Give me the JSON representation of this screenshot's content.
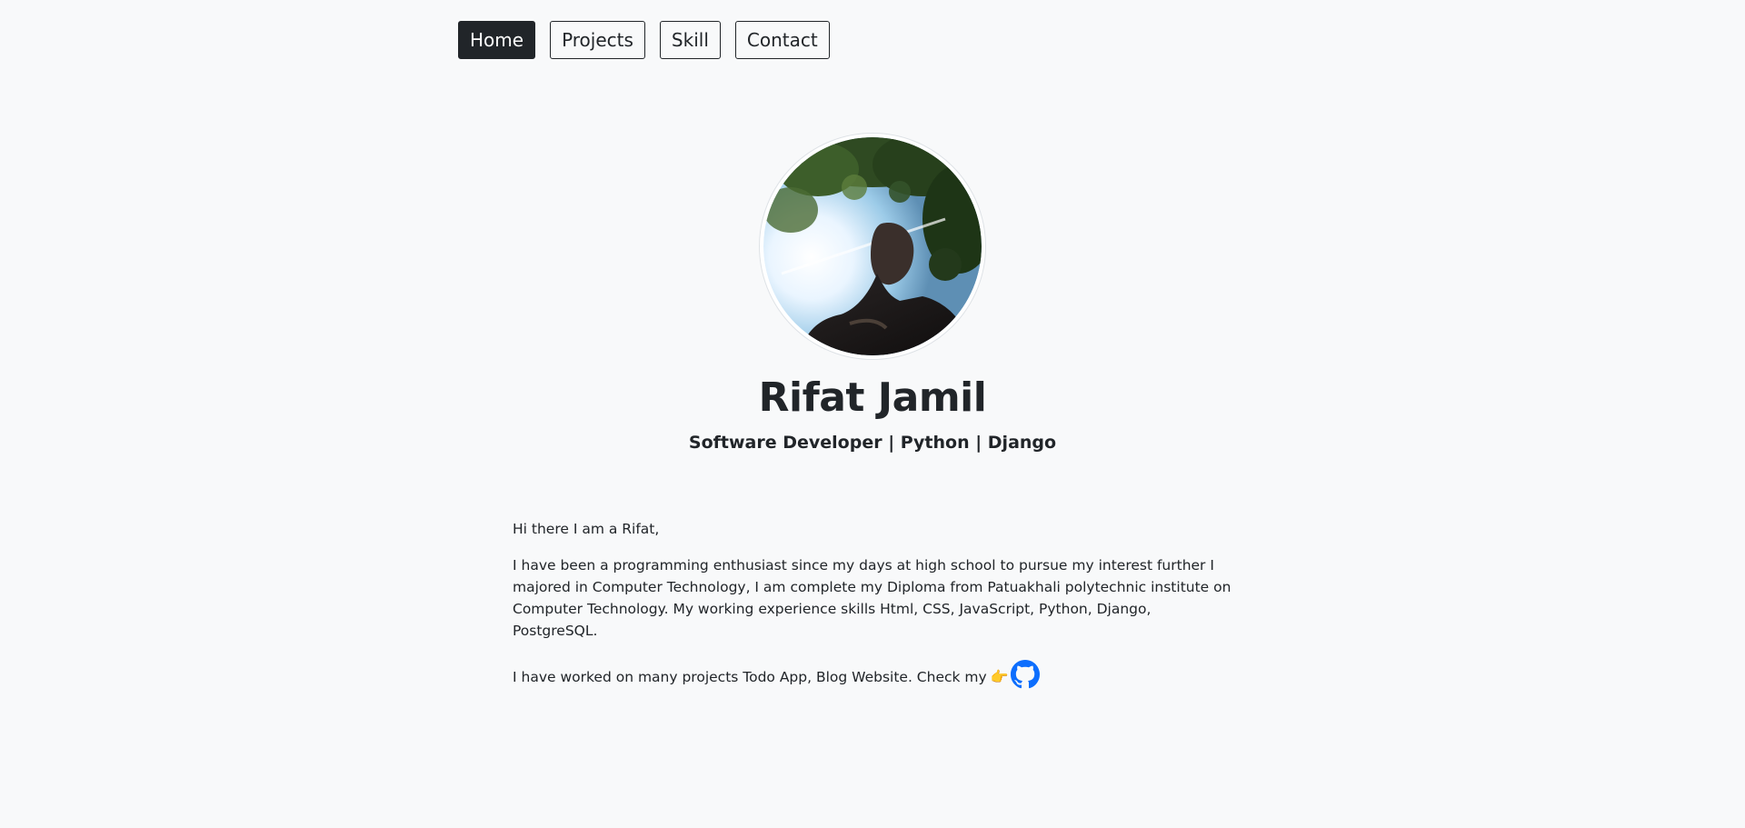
{
  "nav": {
    "items": [
      {
        "label": "Home",
        "active": true
      },
      {
        "label": "Projects",
        "active": false
      },
      {
        "label": "Skill",
        "active": false
      },
      {
        "label": "Contact",
        "active": false
      }
    ]
  },
  "profile": {
    "name": "Rifat Jamil",
    "tagline": "Software Developer | Python | Django",
    "avatar_icon": "profile-photo"
  },
  "about": {
    "greeting": "Hi there I am a Rifat,",
    "bio": "I have been a programming enthusiast since my days at high school to pursue my interest further I majored in Computer Technology, I am complete my Diploma from Patuakhali polytechnic institute on Computer Technology. My working experience skills Html, CSS, JavaScript, Python, Django, PostgreSQL.",
    "projects_text": "I have worked on many projects Todo App, Blog Website. Check my",
    "point_emoji": "👉",
    "github_icon": "github-icon"
  },
  "colors": {
    "background": "#f8f9fa",
    "text": "#212529",
    "github_blue": "#0d6efd"
  }
}
